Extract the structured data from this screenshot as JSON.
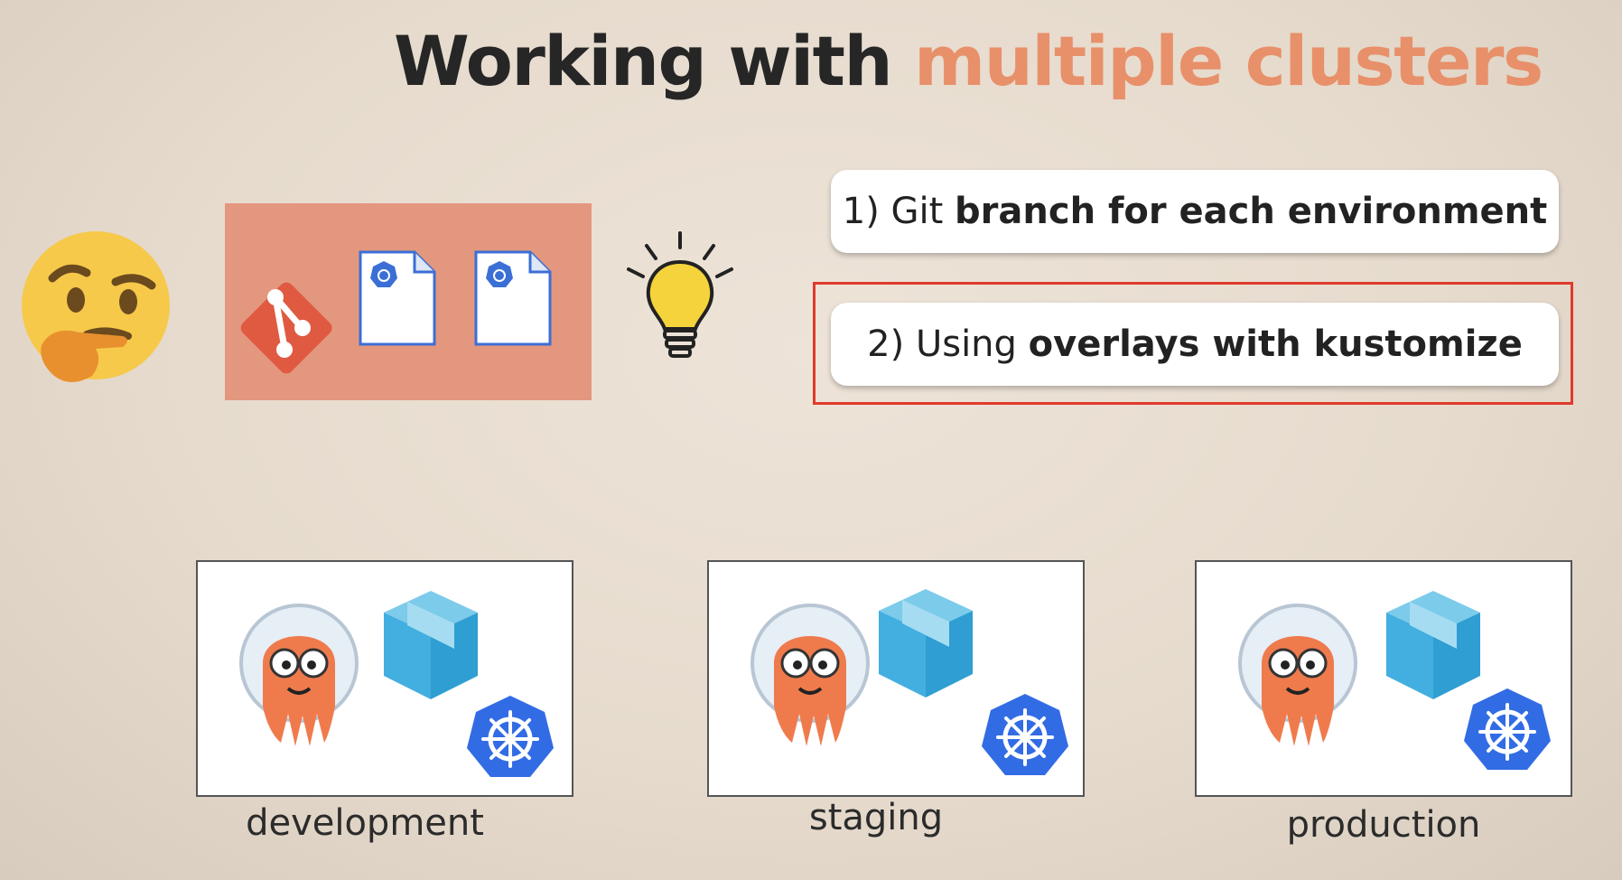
{
  "title": {
    "part1": "Working with ",
    "part2": "multiple clusters"
  },
  "colors": {
    "accent": "#e8906a",
    "highlight": "#e03a2c",
    "repo_box": "#e4977f"
  },
  "options": [
    {
      "number": "1)",
      "normal": "Git",
      "bold": "branch for each environment"
    },
    {
      "number": "2)",
      "normal": "Using",
      "bold": "overlays with kustomize"
    }
  ],
  "clusters": [
    {
      "label": "development"
    },
    {
      "label": "staging"
    },
    {
      "label": "production"
    }
  ],
  "icons": [
    "thinking-face-icon",
    "git-icon",
    "kubernetes-file-icon",
    "lightbulb-icon",
    "argocd-octopus-icon",
    "package-box-icon",
    "kubernetes-icon"
  ]
}
